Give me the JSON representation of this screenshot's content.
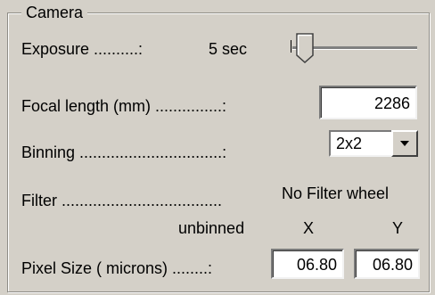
{
  "camera": {
    "group_title": "Camera",
    "exposure": {
      "label": "Exposure ..........:",
      "value": "5 sec"
    },
    "focal_length": {
      "label": "Focal length (mm) ...............:",
      "value": "2286"
    },
    "binning": {
      "label": "Binning ................................:",
      "selected": "2x2"
    },
    "filter": {
      "label": "Filter ....................................",
      "value": "No Filter wheel"
    },
    "pixel_header": {
      "unbinned": "unbinned",
      "x": "X",
      "y": "Y"
    },
    "pixel_size": {
      "label": "Pixel Size ( microns) ........:",
      "x_value": "06.80",
      "y_value": "06.80"
    }
  }
}
